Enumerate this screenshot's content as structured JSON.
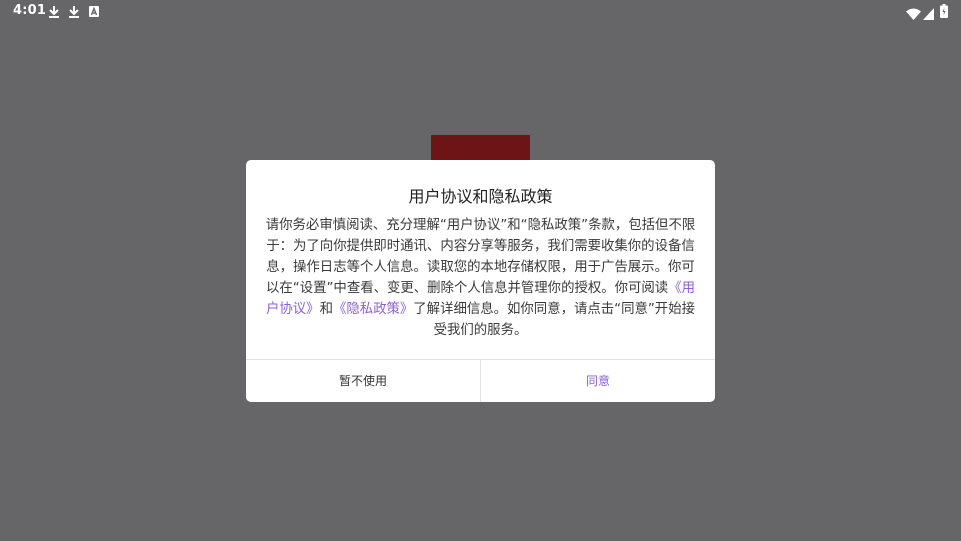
{
  "status_bar": {
    "time": "4:01",
    "left_icons": [
      "download-icon",
      "download-icon",
      "app-notification-icon"
    ],
    "right_icons": [
      "wifi-icon",
      "signal-icon",
      "battery-charging-icon"
    ]
  },
  "dialog": {
    "title": "用户协议和隐私政策",
    "body_part1": "请你务必审慎阅读、充分理解“用户协议”和“隐私政策”条款，包括但不限于：为了向你提供即时通讯、内容分享等服务，我们需要收集你的设备信息，操作日志等个人信息。读取您的本地存储权限，用于广告展示。你可以在“设置”中查看、变更、删除个人信息并管理你的授权。你可阅读",
    "link_user_agreement": "《用户协议》",
    "body_and": "和",
    "link_privacy_policy": "《隐私政策》",
    "body_part2": "了解详细信息。如你同意，请点击“同意”开始接受我们的服务。",
    "decline_label": "暂不使用",
    "agree_label": "同意",
    "link_color": "#8f5fd3"
  }
}
